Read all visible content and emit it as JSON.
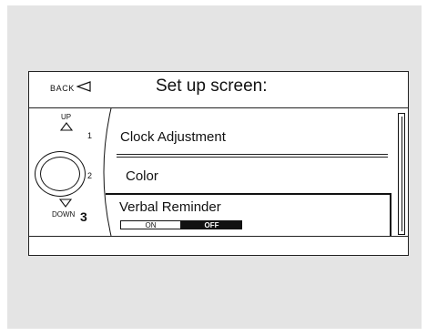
{
  "header": {
    "back_label": "BACK",
    "title": "Set up screen:"
  },
  "controls": {
    "up_label": "UP",
    "down_label": "DOWN",
    "num_1": "1",
    "num_2": "2",
    "num_3": "3"
  },
  "menu": {
    "items": [
      {
        "label": "Clock Adjustment"
      },
      {
        "label": "Color"
      },
      {
        "label": "Verbal Reminder"
      }
    ]
  },
  "toggle": {
    "on_label": "ON",
    "off_label": "OFF",
    "selected": "OFF"
  }
}
